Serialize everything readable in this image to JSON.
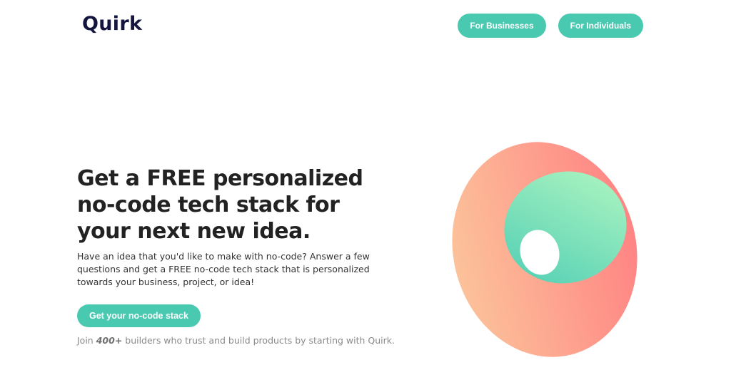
{
  "brand": {
    "logo_text": "Quirk"
  },
  "nav": {
    "businesses_label": "For Businesses",
    "individuals_label": "For Individuals"
  },
  "hero": {
    "headline_lines": [
      "Get a FREE personalized",
      "no-code tech stack for",
      "your next new idea."
    ],
    "subtext": "Have an idea that you'd like to make with no-code? Answer a few questions and get a FREE no-code tech stack that is personalized towards your business, project, or idea!",
    "cta_label": "Get your no-code stack",
    "social_prefix": "Join ",
    "social_count": "400+",
    "social_suffix": " builders who trust and build products by starting with Quirk."
  },
  "colors": {
    "brand_teal": "#48c9b0",
    "logo_navy": "#14163d",
    "art_outer_start": "#fcc29a",
    "art_outer_end": "#ff8484",
    "art_inner_start": "#4ecdb4",
    "art_inner_end": "#b2f7c1"
  }
}
